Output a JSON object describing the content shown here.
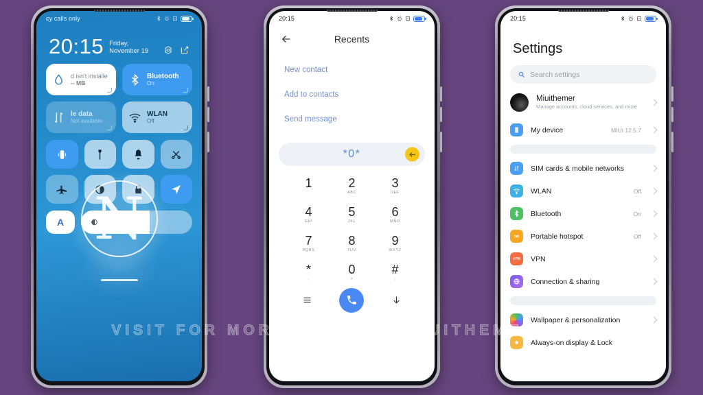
{
  "background_color": "#65457d",
  "watermark": "VISIT FOR MORE THEMES - MIUITHEMER.COM",
  "phone1": {
    "name": "lock-screen-control-center",
    "status_bar": {
      "carrier": "cy calls only",
      "icons": [
        "bluetooth-icon",
        "alarm-icon",
        "dnd-icon",
        "battery-icon"
      ]
    },
    "clock": {
      "time": "20:15",
      "date": "Friday, November 19"
    },
    "clock_actions": [
      "camera-icon",
      "edit-icon"
    ],
    "tiles": [
      {
        "name": "sd-card",
        "title": "d isn't installe",
        "sub": "-- MB",
        "style": "white",
        "icon": "water-drop-icon"
      },
      {
        "name": "bluetooth",
        "title": "Bluetooth",
        "sub": "On",
        "style": "blue",
        "icon": "bluetooth-icon"
      },
      {
        "name": "mobile-data",
        "title": "le data",
        "sub": "Not available",
        "style": "dim",
        "icon": "data-arrows-icon"
      },
      {
        "name": "wlan",
        "title": "WLAN",
        "sub": "Off",
        "style": "light",
        "icon": "wifi-icon"
      }
    ],
    "toggles": [
      {
        "name": "vibrate",
        "icon": "vibrate-icon",
        "style": "on"
      },
      {
        "name": "flashlight",
        "icon": "flashlight-icon",
        "style": "sel"
      },
      {
        "name": "ringer",
        "icon": "bell-icon",
        "style": "sel"
      },
      {
        "name": "screenshot",
        "icon": "scissors-icon",
        "style": "dark"
      },
      {
        "name": "airplane-mode",
        "icon": "airplane-icon",
        "style": "off"
      },
      {
        "name": "dark-mode",
        "icon": "contrast-icon",
        "style": "sel"
      },
      {
        "name": "screen-lock",
        "icon": "lock-icon",
        "style": "sel"
      },
      {
        "name": "location",
        "icon": "location-arrow-icon",
        "style": "on"
      }
    ],
    "brightness": {
      "auto_label": "A",
      "icon": "brightness-icon",
      "level": 62
    },
    "overlay_letter": "N"
  },
  "phone2": {
    "name": "dialer-recents",
    "status_bar": {
      "time": "20:15",
      "icons": [
        "bluetooth-icon",
        "alarm-icon",
        "dnd-icon",
        "battery-icon"
      ]
    },
    "header": {
      "back": "back-arrow-icon",
      "title": "Recents"
    },
    "links": [
      "New contact",
      "Add to contacts",
      "Send message"
    ],
    "input": {
      "value": "*0*",
      "delete_icon": "backspace-icon"
    },
    "keypad": [
      {
        "num": "1",
        "sub": ""
      },
      {
        "num": "2",
        "sub": "ABC"
      },
      {
        "num": "3",
        "sub": "DEF"
      },
      {
        "num": "4",
        "sub": "GHI"
      },
      {
        "num": "5",
        "sub": "JKL"
      },
      {
        "num": "6",
        "sub": "MNO"
      },
      {
        "num": "7",
        "sub": "PQRS"
      },
      {
        "num": "8",
        "sub": "TUV"
      },
      {
        "num": "9",
        "sub": "WXYZ"
      },
      {
        "num": "*",
        "sub": ","
      },
      {
        "num": "0",
        "sub": "+"
      },
      {
        "num": "#",
        "sub": ";"
      }
    ],
    "actions": {
      "menu_icon": "menu-icon",
      "call_icon": "phone-icon",
      "hide_icon": "down-arrow-icon"
    }
  },
  "phone3": {
    "name": "settings",
    "status_bar": {
      "time": "20:15",
      "icons": [
        "bluetooth-icon",
        "alarm-icon",
        "dnd-icon",
        "battery-icon"
      ]
    },
    "title": "Settings",
    "search": {
      "placeholder": "Search settings",
      "icon": "search-icon"
    },
    "account": {
      "name": "Miuithemer",
      "sub": "Manage accounts, cloud services, and more",
      "avatar": "avatar"
    },
    "rows": [
      {
        "label": "My device",
        "value": "MIUI 12.5.7",
        "icon": "phone-device-icon",
        "color": "#4a9ff5"
      },
      {
        "label": "",
        "value": "",
        "icon": "",
        "color": "",
        "type": "gap"
      },
      {
        "label": "SIM cards & mobile networks",
        "value": "",
        "icon": "sim-icon",
        "color": "#4a9ff5"
      },
      {
        "label": "WLAN",
        "value": "Off",
        "icon": "wifi-icon",
        "color": "#3eb0e8"
      },
      {
        "label": "Bluetooth",
        "value": "On",
        "icon": "bluetooth-icon",
        "color": "#4cc264"
      },
      {
        "label": "Portable hotspot",
        "value": "Off",
        "icon": "hotspot-icon",
        "color": "#f5a623"
      },
      {
        "label": "VPN",
        "value": "",
        "icon": "vpn-icon",
        "color": "#f26d43"
      },
      {
        "label": "Connection & sharing",
        "value": "",
        "icon": "globe-icon",
        "color": "#8a63e8"
      },
      {
        "label": "",
        "value": "",
        "icon": "",
        "color": "",
        "type": "gap"
      },
      {
        "label": "Wallpaper & personalization",
        "value": "",
        "icon": "palette-icon",
        "color": "#e8457b"
      },
      {
        "label": "Always-on display & Lock",
        "value": "",
        "icon": "aod-icon",
        "color": "#f5b942"
      }
    ]
  }
}
